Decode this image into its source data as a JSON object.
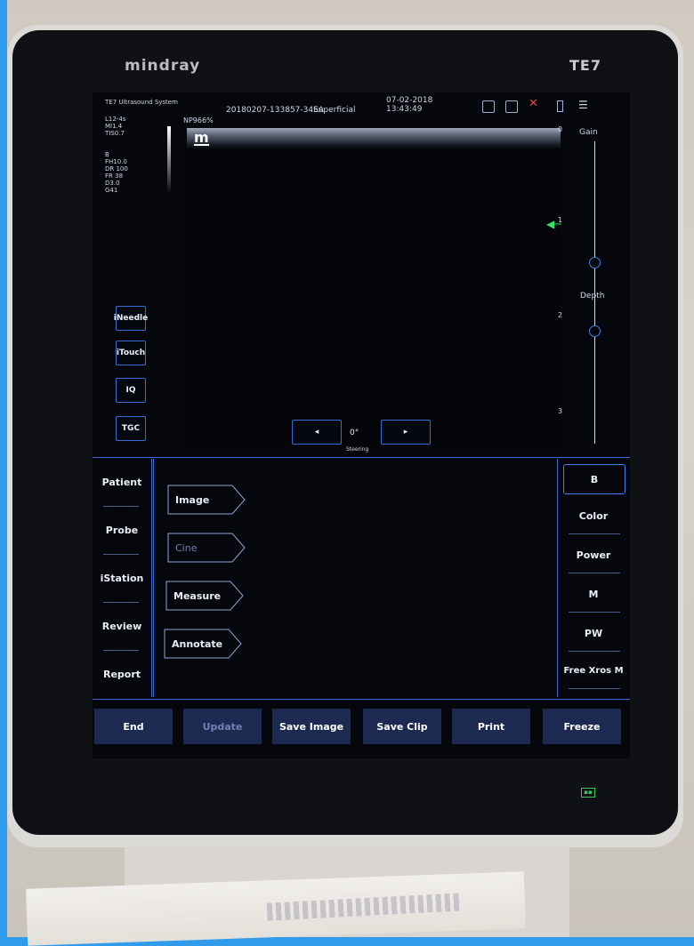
{
  "device": {
    "brand": "mindray",
    "model": "TE7",
    "status_led": "▪▪"
  },
  "header": {
    "system": "TE7 Ultrasound System",
    "exam_id": "20180207-133857-34EA",
    "preset": "Superficial",
    "date": "07-02-2018",
    "time": "13:43:49",
    "np": "NP966%"
  },
  "params": {
    "block1": "L12-4s\nMI1.4\nTIS0.7",
    "block2": "B\nFH10.0\nDR 100\nFR 38\nD3.0\nG41"
  },
  "image": {
    "logo": "m",
    "depth_ticks": [
      "0",
      "1",
      "2",
      "3"
    ]
  },
  "side_controls": {
    "gain_label": "Gain",
    "depth_label": "Depth",
    "gain_level": 0.4,
    "depth_level": 0.25
  },
  "quick_buttons": [
    "iNeedle",
    "iTouch",
    "IQ",
    "TGC"
  ],
  "steering": {
    "left": "◂",
    "right": "▸",
    "value": "0°",
    "label": "Steering"
  },
  "left_menu": [
    "Patient",
    "Probe",
    "iStation",
    "Review",
    "Report"
  ],
  "tabs": [
    {
      "label": "Image",
      "enabled": true
    },
    {
      "label": "Cine",
      "enabled": false
    },
    {
      "label": "Measure",
      "enabled": true
    },
    {
      "label": "Annotate",
      "enabled": true
    }
  ],
  "modes": [
    "B",
    "Color",
    "Power",
    "M",
    "PW",
    "Free Xros M"
  ],
  "active_mode": "B",
  "bottom_buttons": [
    {
      "label": "End",
      "enabled": true
    },
    {
      "label": "Update",
      "enabled": false
    },
    {
      "label": "Save Image",
      "enabled": true
    },
    {
      "label": "Save Clip",
      "enabled": true
    },
    {
      "label": "Print",
      "enabled": true
    },
    {
      "label": "Freeze",
      "enabled": true
    }
  ],
  "colors": {
    "accent": "#3a6cd6",
    "button_bg": "#1c2a52",
    "green_marker": "#3ee06a"
  }
}
